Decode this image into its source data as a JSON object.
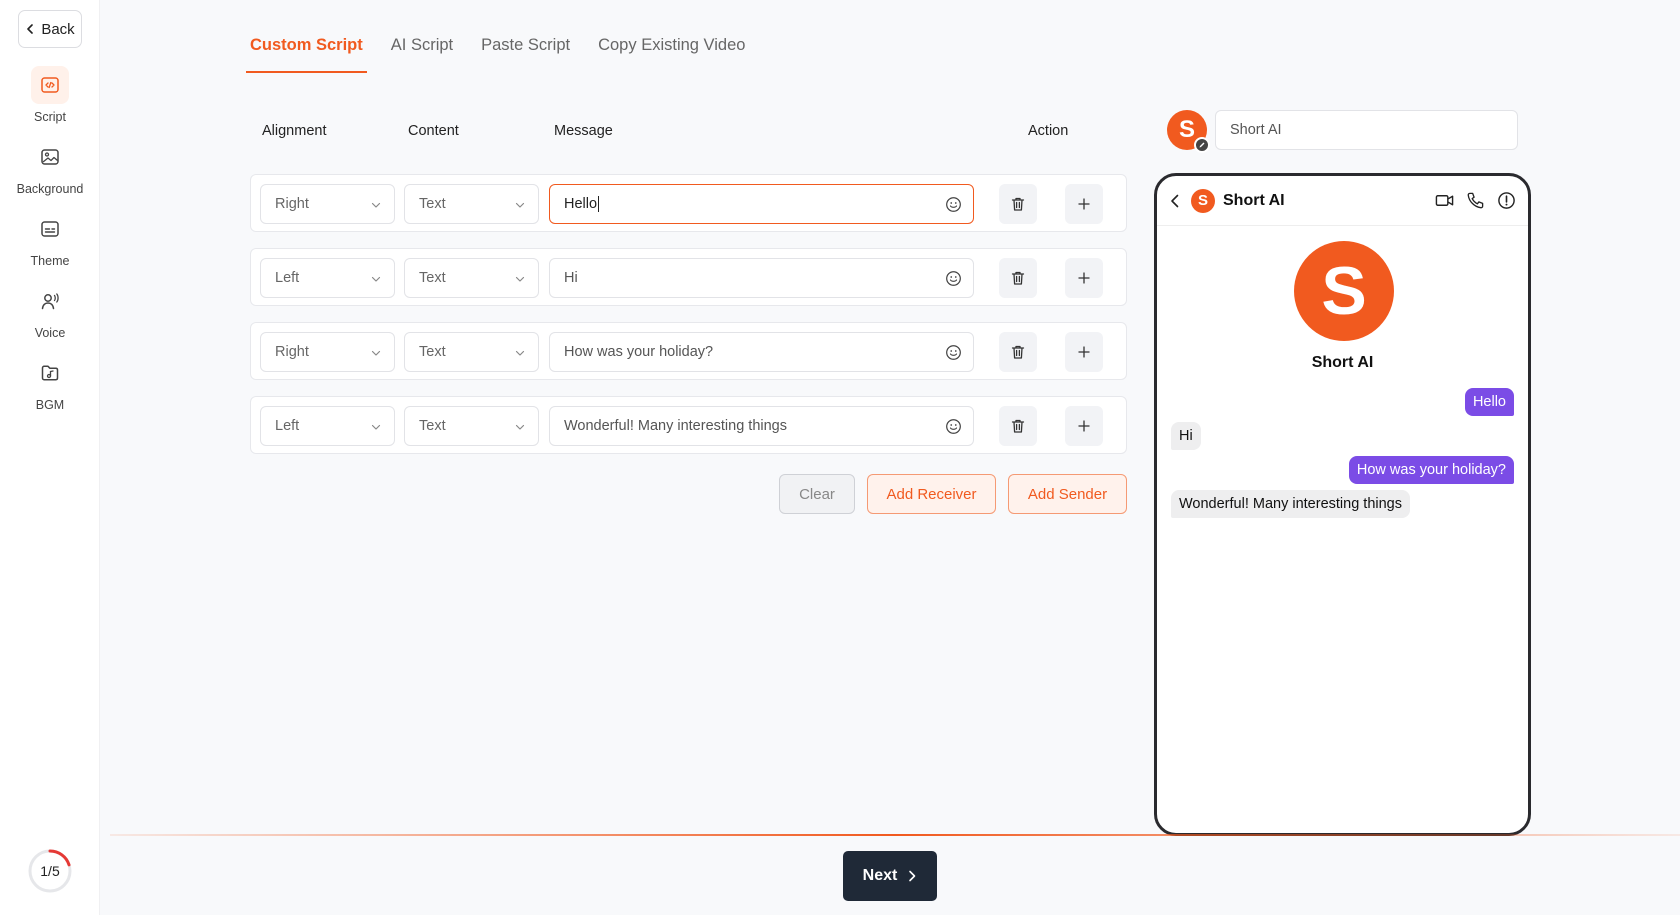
{
  "sidebar": {
    "back_label": "Back",
    "items": [
      {
        "label": "Script",
        "icon": "code-icon",
        "active": true
      },
      {
        "label": "Background",
        "icon": "image-icon",
        "active": false
      },
      {
        "label": "Theme",
        "icon": "theme-icon",
        "active": false
      },
      {
        "label": "Voice",
        "icon": "voice-icon",
        "active": false
      },
      {
        "label": "BGM",
        "icon": "music-folder-icon",
        "active": false
      }
    ],
    "progress": {
      "label": "1/5",
      "fraction": 0.2
    }
  },
  "tabs": [
    {
      "label": "Custom Script",
      "active": true
    },
    {
      "label": "AI Script",
      "active": false
    },
    {
      "label": "Paste Script",
      "active": false
    },
    {
      "label": "Copy Existing Video",
      "active": false
    }
  ],
  "table": {
    "headers": {
      "alignment": "Alignment",
      "content": "Content",
      "message": "Message",
      "action": "Action"
    },
    "rows": [
      {
        "alignment": "Right",
        "content": "Text",
        "message": "Hello",
        "focused": true
      },
      {
        "alignment": "Left",
        "content": "Text",
        "message": "Hi",
        "focused": false
      },
      {
        "alignment": "Right",
        "content": "Text",
        "message": "How was your holiday?",
        "focused": false
      },
      {
        "alignment": "Left",
        "content": "Text",
        "message": "Wonderful! Many interesting things",
        "focused": false
      }
    ]
  },
  "buttons": {
    "clear": "Clear",
    "add_receiver": "Add Receiver",
    "add_sender": "Add Sender",
    "next": "Next"
  },
  "profile": {
    "avatar_letter": "S",
    "name_value": "Short AI"
  },
  "phone": {
    "contact_name": "Short AI",
    "avatar_letter": "S",
    "messages": [
      {
        "side": "right",
        "text": "Hello"
      },
      {
        "side": "left",
        "text": "Hi"
      },
      {
        "side": "right",
        "text": "How was your holiday?"
      },
      {
        "side": "left",
        "text": "Wonderful! Many interesting things"
      }
    ]
  },
  "colors": {
    "accent": "#f15a1f",
    "sender_bubble": "#7b4ce6",
    "receiver_bubble": "#eeeeef",
    "next_button": "#1f2937"
  }
}
